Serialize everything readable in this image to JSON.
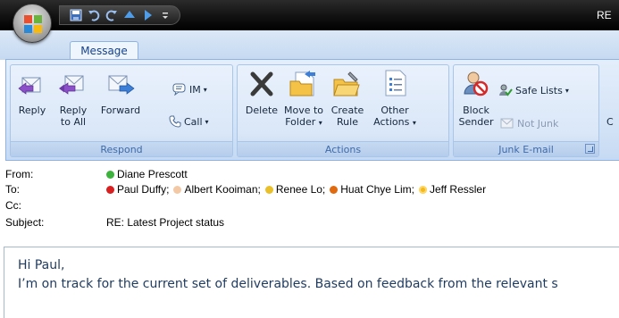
{
  "window": {
    "title": "RE"
  },
  "ribbon": {
    "tabs": [
      {
        "label": "Message"
      }
    ],
    "groups": {
      "respond": {
        "label": "Respond",
        "reply": "Reply",
        "reply_all_line1": "Reply",
        "reply_all_line2": "to All",
        "forward": "Forward",
        "im": "IM",
        "call": "Call"
      },
      "actions": {
        "label": "Actions",
        "delete": "Delete",
        "move_line1": "Move to",
        "move_line2": "Folder",
        "rule_line1": "Create",
        "rule_line2": "Rule",
        "other_line1": "Other",
        "other_line2": "Actions"
      },
      "junk": {
        "label": "Junk E-mail",
        "block_line1": "Block",
        "block_line2": "Sender",
        "safe_lists": "Safe Lists",
        "not_junk": "Not Junk"
      }
    },
    "cut_off_label": "C"
  },
  "message": {
    "from_label": "From:",
    "to_label": "To:",
    "cc_label": "Cc:",
    "subject_label": "Subject:",
    "from": {
      "name": "Diane Prescott",
      "status_color": "#3db33d"
    },
    "to": [
      {
        "name": "Paul Duffy;",
        "status": "busy",
        "status_color": "#d82020"
      },
      {
        "name": "Albert Kooiman;",
        "status": "offline",
        "status_color": "#f3c9a5"
      },
      {
        "name": "Renee Lo;",
        "status": "away",
        "status_color": "#e9c02a"
      },
      {
        "name": "Huat Chye Lim;",
        "status": "busy-away",
        "status_color": "#e06a10"
      },
      {
        "name": "Jeff Ressler",
        "status": "away-alt",
        "status_color": "#f2b81e"
      }
    ],
    "subject": "RE: Latest Project status",
    "body": {
      "greeting": "Hi Paul,",
      "line1": "I’m on track for the current set of deliverables. Based on feedback from the relevant s"
    }
  }
}
